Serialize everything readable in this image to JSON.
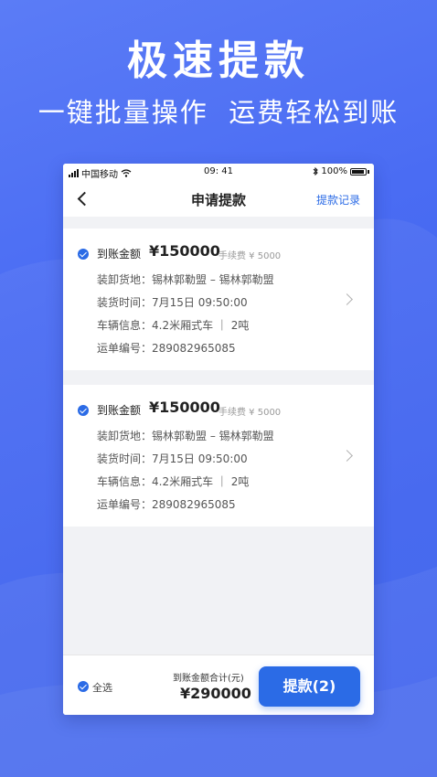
{
  "promo": {
    "title": "极速提款",
    "subtitle": "一键批量操作  运费轻松到账"
  },
  "status_bar": {
    "carrier": "中国移动",
    "time": "09: 41",
    "battery": "100%"
  },
  "nav": {
    "title": "申请提款",
    "record_link": "提款记录"
  },
  "cards": [
    {
      "amount_label": "到账金额",
      "amount": "¥150000",
      "fee": "手续费 ¥ 5000",
      "rows": [
        {
          "label": "装卸货地：",
          "value": "锡林郭勒盟 – 锡林郭勒盟"
        },
        {
          "label": "装货时间：",
          "value": "7月15日 09:50:00"
        },
        {
          "label": "车辆信息：",
          "value": "4.2米厢式车 ｜ 2吨"
        },
        {
          "label": "运单编号：",
          "value": "289082965085"
        }
      ]
    },
    {
      "amount_label": "到账金额",
      "amount": "¥150000",
      "fee": "手续费 ¥ 5000",
      "rows": [
        {
          "label": "装卸货地：",
          "value": "锡林郭勒盟 – 锡林郭勒盟"
        },
        {
          "label": "装货时间：",
          "value": "7月15日 09:50:00"
        },
        {
          "label": "车辆信息：",
          "value": "4.2米厢式车 ｜ 2吨"
        },
        {
          "label": "运单编号：",
          "value": "289082965085"
        }
      ]
    }
  ],
  "bottom": {
    "select_all": "全选",
    "total_label": "到账金额合计(元)",
    "total_value": "¥290000",
    "withdraw_button": "提款(2)"
  },
  "colors": {
    "accent": "#2b6be6",
    "background": "#4a6cf3"
  }
}
